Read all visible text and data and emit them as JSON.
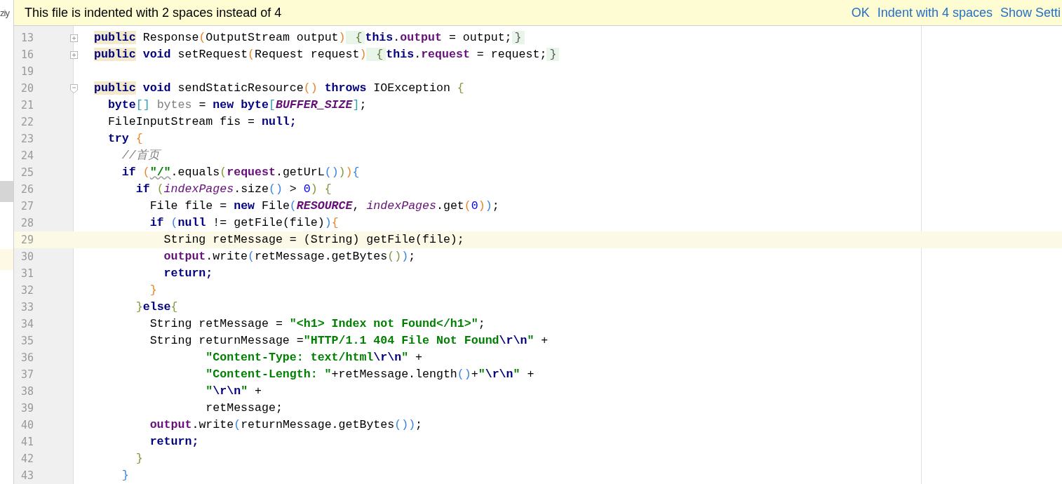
{
  "side_panel": {
    "text": "ziy"
  },
  "notification": {
    "message": "This file is indented with 2 spaces instead of 4",
    "actions": [
      "OK",
      "Indent with 4 spaces",
      "Show Setti"
    ]
  },
  "lines": [
    {
      "number": "13",
      "fold_marker": {
        "collapsed": true
      },
      "current": false,
      "tokens": [
        {
          "t": "public",
          "kind": "usage"
        },
        {
          "t": " Response",
          "kind": "plain"
        },
        {
          "t": "(",
          "kind": "bracket",
          "color": "#e8862a"
        },
        {
          "t": "OutputStream output",
          "kind": "plain"
        },
        {
          "t": ")",
          "kind": "bracket",
          "color": "#e8862a"
        },
        {
          "t": " {",
          "kind": "foldbrace",
          "color": "#5f7f3a"
        },
        {
          "t": "this",
          "kind": "keyword"
        },
        {
          "t": ".",
          "kind": "plain"
        },
        {
          "t": "output",
          "kind": "field"
        },
        {
          "t": " = output;",
          "kind": "plain"
        },
        {
          "t": "}",
          "kind": "foldbrace",
          "color": "#5a5a5a"
        }
      ]
    },
    {
      "number": "16",
      "fold_marker": {
        "collapsed": true
      },
      "current": false,
      "tokens": [
        {
          "t": "public",
          "kind": "usage"
        },
        {
          "t": " void",
          "kind": "keyword"
        },
        {
          "t": " setRequest",
          "kind": "plain"
        },
        {
          "t": "(",
          "kind": "bracket",
          "color": "#e8862a"
        },
        {
          "t": "Request request",
          "kind": "plain"
        },
        {
          "t": ")",
          "kind": "bracket",
          "color": "#e8862a"
        },
        {
          "t": " {",
          "kind": "foldbrace",
          "color": "#5f7f3a"
        },
        {
          "t": "this",
          "kind": "keyword"
        },
        {
          "t": ".",
          "kind": "plain"
        },
        {
          "t": "request",
          "kind": "field"
        },
        {
          "t": " = request;",
          "kind": "plain"
        },
        {
          "t": "}",
          "kind": "foldbrace",
          "color": "#5a5a5a"
        }
      ]
    },
    {
      "number": "19",
      "current": false
    },
    {
      "number": "20",
      "fold_marker": {
        "collapsed": false
      },
      "current": false,
      "tokens": [
        {
          "t": "public",
          "kind": "usage"
        },
        {
          "t": " void",
          "kind": "keyword"
        },
        {
          "t": " sendStaticResource",
          "kind": "plain"
        },
        {
          "t": "()",
          "kind": "bracket",
          "color": "#e8862a"
        },
        {
          "t": " throws",
          "kind": "keyword"
        },
        {
          "t": " IOException ",
          "kind": "plain"
        },
        {
          "t": "{",
          "kind": "bracket",
          "color": "#7f9a3a"
        }
      ]
    },
    {
      "number": "21",
      "current": false,
      "tokens": [
        {
          "t": "  byte",
          "kind": "keyword"
        },
        {
          "t": "[]",
          "kind": "bracket",
          "color": "#2aa0b0"
        },
        {
          "t": " bytes",
          "kind": "unused"
        },
        {
          "t": " = ",
          "kind": "plain"
        },
        {
          "t": "new byte",
          "kind": "keyword"
        },
        {
          "t": "[",
          "kind": "bracket",
          "color": "#2aa0b0"
        },
        {
          "t": "BUFFER_SIZE",
          "kind": "constant"
        },
        {
          "t": "]",
          "kind": "bracket",
          "color": "#2aa0b0"
        },
        {
          "t": ";",
          "kind": "plain"
        }
      ]
    },
    {
      "number": "22",
      "current": false,
      "tokens": [
        {
          "t": "  FileInputStream fis = ",
          "kind": "plain"
        },
        {
          "t": "null;",
          "kind": "keyword"
        }
      ]
    },
    {
      "number": "23",
      "current": false,
      "tokens": [
        {
          "t": "  try",
          "kind": "keyword"
        },
        {
          "t": " {",
          "kind": "bracket",
          "color": "#e8862a"
        }
      ]
    },
    {
      "number": "24",
      "current": false,
      "tokens": [
        {
          "t": "    //首页",
          "kind": "comment"
        }
      ]
    },
    {
      "number": "25",
      "current": false,
      "tokens": [
        {
          "t": "    if",
          "kind": "keyword"
        },
        {
          "t": " (",
          "kind": "bracket",
          "color": "#e8862a"
        },
        {
          "t": "\"/\"",
          "kind": "warnstring"
        },
        {
          "t": ".equals",
          "kind": "plain"
        },
        {
          "t": "(",
          "kind": "bracket",
          "color": "#7f9a3a"
        },
        {
          "t": "request",
          "kind": "field"
        },
        {
          "t": ".getUrL",
          "kind": "plain"
        },
        {
          "t": "()",
          "kind": "bracket",
          "color": "#3a84e0"
        },
        {
          "t": ")",
          "kind": "bracket",
          "color": "#7f9a3a"
        },
        {
          "t": ")",
          "kind": "bracket",
          "color": "#e8862a"
        },
        {
          "t": "{",
          "kind": "bracket",
          "color": "#3a84e0"
        }
      ]
    },
    {
      "number": "26",
      "current": false,
      "tokens": [
        {
          "t": "      if",
          "kind": "keyword"
        },
        {
          "t": " (",
          "kind": "bracket",
          "color": "#7f9a3a"
        },
        {
          "t": "indexPages",
          "kind": "static"
        },
        {
          "t": ".size",
          "kind": "plain"
        },
        {
          "t": "()",
          "kind": "bracket",
          "color": "#3a84e0"
        },
        {
          "t": " > ",
          "kind": "plain"
        },
        {
          "t": "0",
          "kind": "number"
        },
        {
          "t": ")",
          "kind": "bracket",
          "color": "#7f9a3a"
        },
        {
          "t": " {",
          "kind": "bracket",
          "color": "#7f9a3a"
        }
      ]
    },
    {
      "number": "27",
      "current": false,
      "tokens": [
        {
          "t": "        File file = ",
          "kind": "plain"
        },
        {
          "t": "new",
          "kind": "keyword"
        },
        {
          "t": " File",
          "kind": "plain"
        },
        {
          "t": "(",
          "kind": "bracket",
          "color": "#3a84e0"
        },
        {
          "t": "RESOURCE",
          "kind": "constant"
        },
        {
          "t": ", ",
          "kind": "plain"
        },
        {
          "t": "indexPages",
          "kind": "static"
        },
        {
          "t": ".get",
          "kind": "plain"
        },
        {
          "t": "(",
          "kind": "bracket",
          "color": "#e8862a"
        },
        {
          "t": "0",
          "kind": "number"
        },
        {
          "t": ")",
          "kind": "bracket",
          "color": "#e8862a"
        },
        {
          "t": ")",
          "kind": "bracket",
          "color": "#3a84e0"
        },
        {
          "t": ";",
          "kind": "plain"
        }
      ]
    },
    {
      "number": "28",
      "current": false,
      "tokens": [
        {
          "t": "        if",
          "kind": "keyword"
        },
        {
          "t": " (",
          "kind": "bracket",
          "color": "#3a84e0"
        },
        {
          "t": "null",
          "kind": "keyword"
        },
        {
          "t": " != getFile(file)",
          "kind": "plain"
        },
        {
          "t": ")",
          "kind": "bracket",
          "color": "#3a84e0"
        },
        {
          "t": "{",
          "kind": "bracket",
          "color": "#e8862a"
        }
      ]
    },
    {
      "number": "29",
      "current": true,
      "tokens": [
        {
          "t": "          String retMessage = (String) getFile(file);",
          "kind": "plain"
        }
      ]
    },
    {
      "number": "30",
      "current": false,
      "tokens": [
        {
          "t": "          output",
          "kind": "field"
        },
        {
          "t": ".write",
          "kind": "plain"
        },
        {
          "t": "(",
          "kind": "bracket",
          "color": "#3a84e0"
        },
        {
          "t": "retMessage.getBytes",
          "kind": "plain"
        },
        {
          "t": "()",
          "kind": "bracket",
          "color": "#7f9a3a"
        },
        {
          "t": ")",
          "kind": "bracket",
          "color": "#3a84e0"
        },
        {
          "t": ";",
          "kind": "plain"
        }
      ]
    },
    {
      "number": "31",
      "current": false,
      "tokens": [
        {
          "t": "          return;",
          "kind": "keyword"
        }
      ]
    },
    {
      "number": "32",
      "current": false,
      "tokens": [
        {
          "t": "        }",
          "kind": "bracket",
          "color": "#e8862a"
        }
      ]
    },
    {
      "number": "33",
      "current": false,
      "tokens": [
        {
          "t": "      }",
          "kind": "bracket",
          "color": "#7f9a3a"
        },
        {
          "t": "else",
          "kind": "keyword"
        },
        {
          "t": "{",
          "kind": "bracket",
          "color": "#7f9a3a"
        }
      ]
    },
    {
      "number": "34",
      "current": false,
      "tokens": [
        {
          "t": "        String retMessage = ",
          "kind": "plain"
        },
        {
          "t": "\"<h1> Index not Found</h1>\"",
          "kind": "string"
        },
        {
          "t": ";",
          "kind": "plain"
        }
      ]
    },
    {
      "number": "35",
      "current": false,
      "tokens": [
        {
          "t": "        String returnMessage =",
          "kind": "plain"
        },
        {
          "t": "\"HTTP/1.1 404 File Not Found",
          "kind": "string"
        },
        {
          "t": "\\r\\n",
          "kind": "escape"
        },
        {
          "t": "\"",
          "kind": "string"
        },
        {
          "t": " +",
          "kind": "plain"
        }
      ]
    },
    {
      "number": "36",
      "current": false,
      "tokens": [
        {
          "t": "                \"Content-Type: text/html",
          "kind": "string"
        },
        {
          "t": "\\r\\n",
          "kind": "escape"
        },
        {
          "t": "\"",
          "kind": "string"
        },
        {
          "t": " +",
          "kind": "plain"
        }
      ]
    },
    {
      "number": "37",
      "current": false,
      "tokens": [
        {
          "t": "                \"Content-Length: \"",
          "kind": "string"
        },
        {
          "t": "+retMessage.length",
          "kind": "plain"
        },
        {
          "t": "()",
          "kind": "bracket",
          "color": "#3a84e0"
        },
        {
          "t": "+",
          "kind": "plain"
        },
        {
          "t": "\"",
          "kind": "string"
        },
        {
          "t": "\\r\\n",
          "kind": "escape"
        },
        {
          "t": "\"",
          "kind": "string"
        },
        {
          "t": " +",
          "kind": "plain"
        }
      ]
    },
    {
      "number": "38",
      "current": false,
      "tokens": [
        {
          "t": "                \"",
          "kind": "string"
        },
        {
          "t": "\\r\\n",
          "kind": "escape"
        },
        {
          "t": "\"",
          "kind": "string"
        },
        {
          "t": " +",
          "kind": "plain"
        }
      ]
    },
    {
      "number": "39",
      "current": false,
      "tokens": [
        {
          "t": "                retMessage;",
          "kind": "plain"
        }
      ]
    },
    {
      "number": "40",
      "current": false,
      "tokens": [
        {
          "t": "        output",
          "kind": "field"
        },
        {
          "t": ".write",
          "kind": "plain"
        },
        {
          "t": "(",
          "kind": "bracket",
          "color": "#3a84e0"
        },
        {
          "t": "returnMessage.getBytes",
          "kind": "plain"
        },
        {
          "t": "()",
          "kind": "bracket",
          "color": "#3a84e0"
        },
        {
          "t": ")",
          "kind": "bracket",
          "color": "#3a84e0"
        },
        {
          "t": ";",
          "kind": "plain"
        }
      ]
    },
    {
      "number": "41",
      "current": false,
      "tokens": [
        {
          "t": "        return;",
          "kind": "keyword"
        }
      ]
    },
    {
      "number": "42",
      "current": false,
      "tokens": [
        {
          "t": "      }",
          "kind": "bracket",
          "color": "#7f9a3a"
        }
      ]
    },
    {
      "number": "43",
      "current": false,
      "tokens": [
        {
          "t": "    }",
          "kind": "bracket",
          "color": "#3a84e0"
        }
      ]
    }
  ]
}
